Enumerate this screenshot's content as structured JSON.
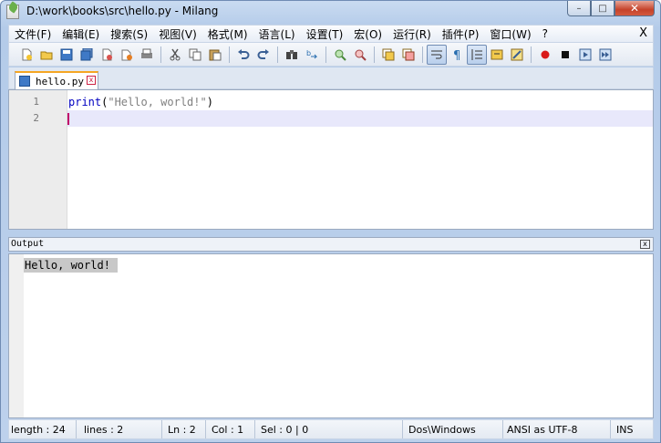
{
  "window": {
    "title": "D:\\work\\books\\src\\hello.py - Milang"
  },
  "window_buttons": {
    "minimize": "–",
    "maximize": "□",
    "close": "✕"
  },
  "menu": {
    "items": [
      "文件(F)",
      "编辑(E)",
      "搜索(S)",
      "视图(V)",
      "格式(M)",
      "语言(L)",
      "设置(T)",
      "宏(O)",
      "运行(R)",
      "插件(P)",
      "窗口(W)",
      "?"
    ],
    "close": "X"
  },
  "toolbar": {
    "icons": [
      "new-file-icon",
      "open-file-icon",
      "save-icon",
      "save-all-icon",
      "close-icon",
      "close-all-icon",
      "print-icon",
      "cut-icon",
      "copy-icon",
      "paste-icon",
      "undo-icon",
      "redo-icon",
      "find-icon",
      "replace-icon",
      "zoom-in-icon",
      "zoom-out-icon",
      "sync-v-icon",
      "sync-h-icon",
      "wrap-icon",
      "show-all-chars-icon",
      "indent-guide-icon",
      "user-lang-icon",
      "doc-map-icon",
      "record-macro-icon",
      "stop-macro-icon",
      "play-macro-icon",
      "run-macro-multiple-icon"
    ]
  },
  "tab": {
    "label": "hello.py",
    "close": "x"
  },
  "editor": {
    "line_numbers": [
      "1",
      "2"
    ],
    "line1": {
      "keyword": "print",
      "open": "(",
      "string": "\"Hello, world!\"",
      "close": ")"
    }
  },
  "output": {
    "title": "Output",
    "close": "x",
    "text": "Hello, world!"
  },
  "status": {
    "length": "length : 24",
    "lines": "lines : 2",
    "ln": "Ln : 2",
    "col": "Col : 1",
    "sel": "Sel : 0 | 0",
    "eol": "Dos\\Windows",
    "encoding": "ANSI as UTF-8",
    "mode": "INS"
  }
}
